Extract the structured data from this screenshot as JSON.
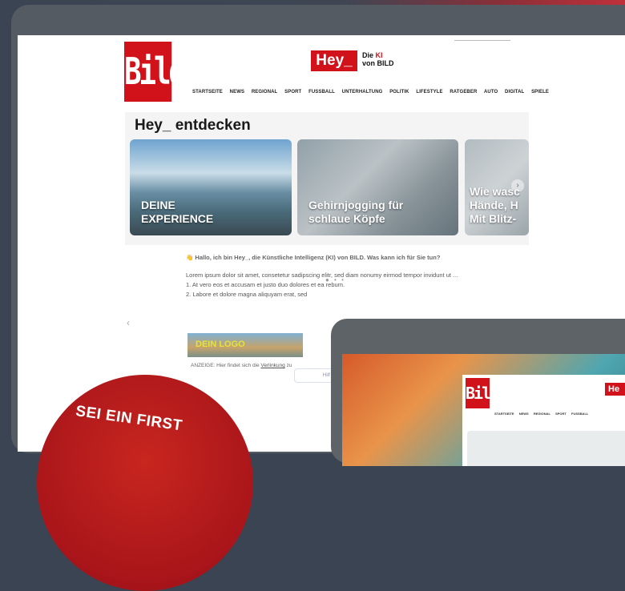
{
  "site": {
    "logo": "Bild",
    "hey_badge": "Hey_",
    "hey_sub_line1_prefix": "Die ",
    "hey_sub_line1_ki": "KI",
    "hey_sub_line2": "von BILD"
  },
  "nav": [
    "STARTSEITE",
    "NEWS",
    "REGIONAL",
    "SPORT",
    "FUSSBALL",
    "UNTERHALTUNG",
    "POLITIK",
    "LIFESTYLE",
    "RATGEBER",
    "AUTO",
    "DIGITAL",
    "SPIELE"
  ],
  "section_title": "Hey_ entdecken",
  "cards": [
    {
      "caption_l1": "DEINE",
      "caption_l2": "EXPERIENCE"
    },
    {
      "caption_l1": "Gehirnjogging für",
      "caption_l2": "schlaue Köpfe"
    },
    {
      "caption_l1": "Wie wasc",
      "caption_l2": "Hände, H",
      "caption_l3": "Mit Blitz-"
    }
  ],
  "chat": {
    "greeting": "👋 Hallo, ich bin Hey_, die Künstliche Intelligenz (KI) von BILD. Was kann ich für Sie tun?",
    "lorem": "Lorem ipsum dolor sit amet, consetetur sadipscing elitr, sed diam nonumy eirmod tempor invidunt ut ...",
    "item1": "1. At vero eos et accusam et justo duo dolores et ea rebum.",
    "item2": "2. Labore et dolore magna aliquyam erat, sed"
  },
  "ad": {
    "logo_text": "DEIN LOGO",
    "note_prefix": "ANZEIGE: Hier findet sich die ",
    "note_link": "Verlinkung",
    "note_suffix": " zu"
  },
  "help_button": "Hilf mir, m",
  "badge_text": "SEI EIN FIRST",
  "tablet": {
    "logo": "Bild",
    "hey": "He",
    "nav": [
      "STARTSEITE",
      "NEWS",
      "REGIONAL",
      "SPORT",
      "FUSSBALL"
    ]
  },
  "colors": {
    "brand_red": "#d1121b",
    "background": "#3a4452"
  }
}
